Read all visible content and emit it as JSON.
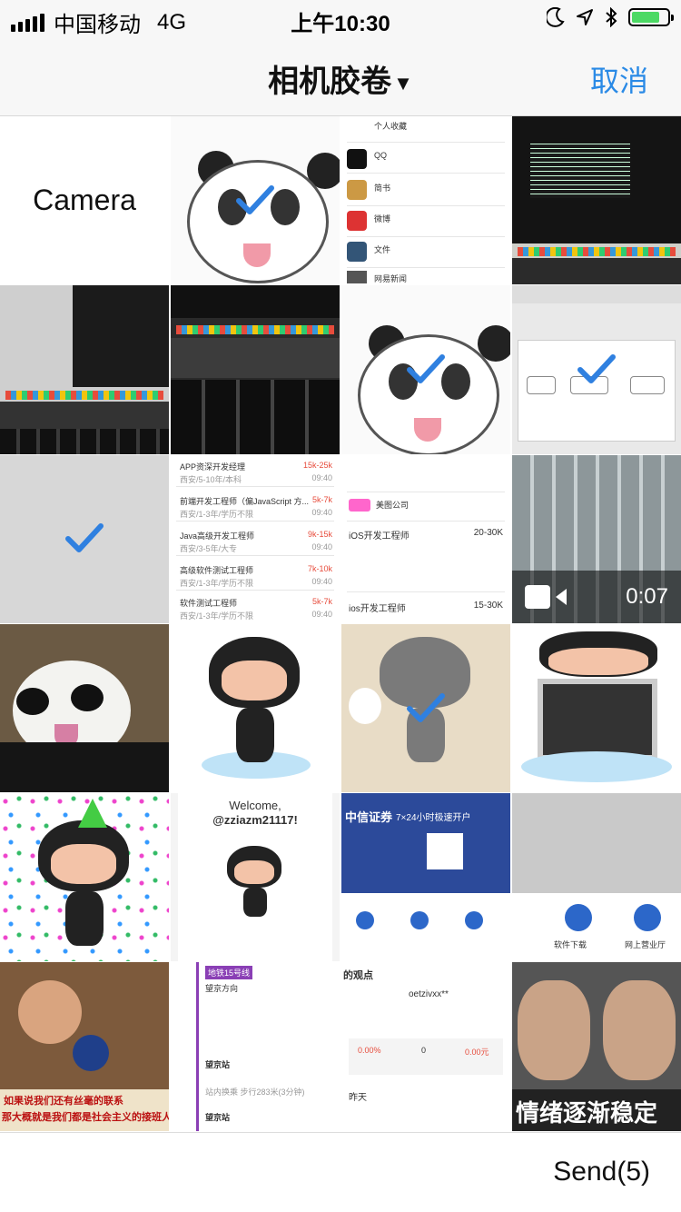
{
  "status_bar": {
    "carrier": "中国移动",
    "network": "4G",
    "time": "上午10:30",
    "battery_level": 0.8
  },
  "nav": {
    "title": "相机胶卷",
    "dropdown_icon": "caret-down-icon",
    "cancel_label": "取消"
  },
  "colors": {
    "accent": "#2a8ae6",
    "battery_fill": "#4cd964",
    "bar_bg": "#f7f7f7"
  },
  "grid": {
    "camera_label": "Camera",
    "video_duration": "0:07",
    "selected_count": 5
  },
  "thumbs": {
    "settings_list": [
      "个人收藏",
      "QQ",
      "简书",
      "微博",
      "文件",
      "网易新闻"
    ],
    "jobs_list": [
      {
        "title": "APP资深开发经理",
        "salary": "15k-25k",
        "sub": "西安/5-10年/本科",
        "time": "09:40"
      },
      {
        "title": "前端开发工程师（偏JavaScript 方...",
        "salary": "5k-7k",
        "sub": "西安/1-3年/学历不限",
        "time": "09:40"
      },
      {
        "title": "Java高级开发工程师",
        "salary": "9k-15k",
        "sub": "西安/3-5年/大专",
        "time": "09:40"
      },
      {
        "title": "高级软件测试工程师",
        "salary": "7k-10k",
        "sub": "西安/1-3年/学历不限",
        "time": "09:40"
      },
      {
        "title": "软件测试工程师",
        "salary": "5k-7k",
        "sub": "西安/1-3年/学历不限",
        "time": "09:40"
      }
    ],
    "ios_jobs": {
      "company": "美图公司",
      "job1": "iOS开发工程师",
      "job1_salary": "20-30K",
      "job2": "ios开发工程师",
      "job2_salary": "15-30K"
    },
    "welcome": {
      "title": "Welcome,",
      "user": "@zziazm21117!"
    },
    "broker": {
      "title": "中信证券",
      "subtitle": "7×24小时极速开户",
      "download": "软件下载",
      "online": "网上营业厅"
    },
    "subway": {
      "line": "地铁15号线",
      "direction": "望京方向",
      "station": "望京站",
      "walk": "站内换乘 步行283米(3分钟)"
    },
    "profile": {
      "heading": "的观点",
      "name": "oetzivxx**",
      "stat1": "0.00%",
      "stat2": "0",
      "stat3": "0.00元",
      "yesterday": "昨天"
    },
    "poster": {
      "line1": "如果说我们还有丝毫的联系",
      "line2": "那大概就是我们都是社会主义的接班人"
    },
    "meme": {
      "caption": "情绪逐渐稳定"
    }
  },
  "bottom": {
    "send_label": "Send(5)"
  }
}
